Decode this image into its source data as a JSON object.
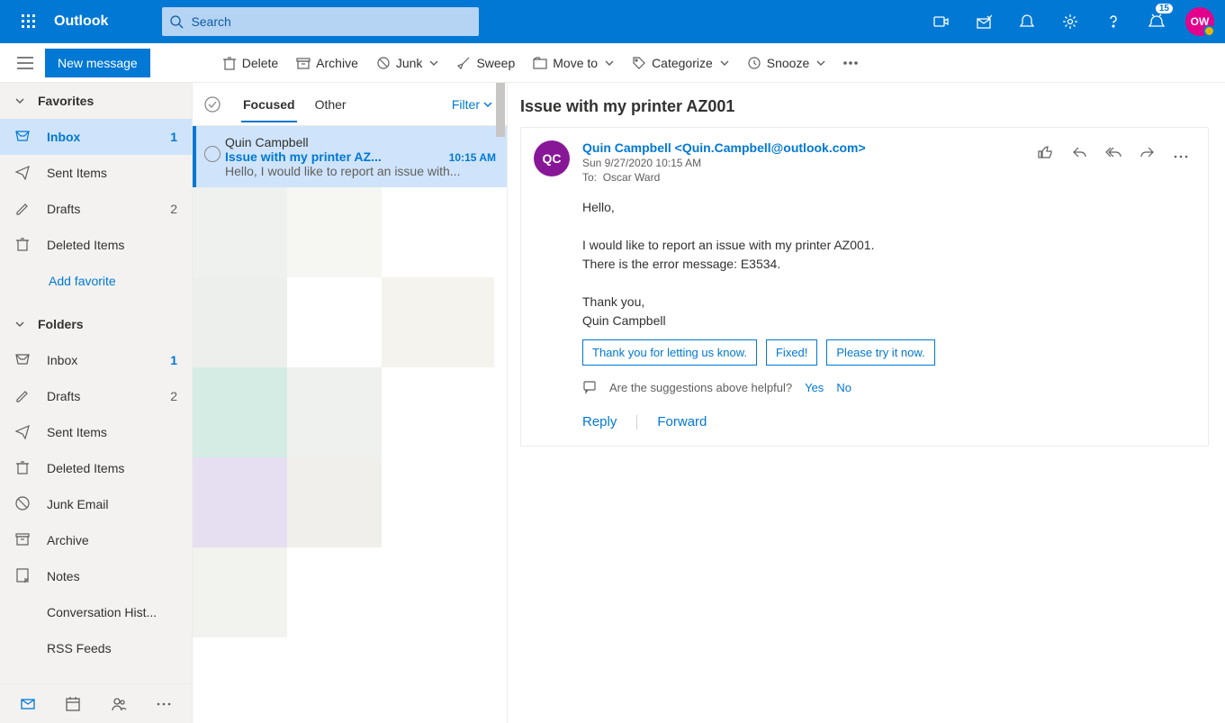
{
  "app": {
    "brand": "Outlook"
  },
  "search": {
    "placeholder": "Search"
  },
  "header": {
    "meet_badge": "15",
    "avatar_initials": "OW"
  },
  "cmdbar": {
    "new_message": "New message",
    "delete": "Delete",
    "archive": "Archive",
    "junk": "Junk",
    "sweep": "Sweep",
    "move_to": "Move to",
    "categorize": "Categorize",
    "snooze": "Snooze"
  },
  "nav": {
    "favorites_header": "Favorites",
    "favorites": [
      {
        "label": "Inbox",
        "count": "1",
        "selected": true,
        "icon": "inbox"
      },
      {
        "label": "Sent Items",
        "icon": "send"
      },
      {
        "label": "Drafts",
        "count": "2",
        "gray": true,
        "icon": "draft"
      },
      {
        "label": "Deleted Items",
        "icon": "trash"
      }
    ],
    "add_favorite": "Add favorite",
    "folders_header": "Folders",
    "folders": [
      {
        "label": "Inbox",
        "count": "1",
        "icon": "inbox"
      },
      {
        "label": "Drafts",
        "count": "2",
        "gray": true,
        "icon": "draft"
      },
      {
        "label": "Sent Items",
        "icon": "send"
      },
      {
        "label": "Deleted Items",
        "icon": "trash"
      },
      {
        "label": "Junk Email",
        "icon": "block"
      },
      {
        "label": "Archive",
        "icon": "archive"
      },
      {
        "label": "Notes",
        "icon": "note"
      },
      {
        "label": "Conversation Hist...",
        "icon": "none"
      },
      {
        "label": "RSS Feeds",
        "icon": "none"
      }
    ]
  },
  "list": {
    "tabs": {
      "focused": "Focused",
      "other": "Other",
      "filter": "Filter"
    },
    "selected": {
      "from": "Quin Campbell",
      "subject": "Issue with my printer AZ...",
      "time": "10:15 AM",
      "preview": "Hello, I would like to report an issue with..."
    }
  },
  "reading": {
    "subject": "Issue with my printer AZ001",
    "avatar_initials": "QC",
    "avatar_color": "#881798",
    "from_display": "Quin Campbell <Quin.Campbell@outlook.com>",
    "date": "Sun 9/27/2020 10:15 AM",
    "to_label": "To:",
    "to_value": "Oscar Ward",
    "body_lines": [
      "Hello,",
      "",
      "I would like to report an issue with my printer AZ001.",
      "There is the error message: E3534.",
      "",
      "Thank you,",
      "Quin Campbell"
    ],
    "suggestions": [
      "Thank you for letting us know.",
      "Fixed!",
      "Please try it now."
    ],
    "helpful_prompt": "Are the suggestions above helpful?",
    "helpful_yes": "Yes",
    "helpful_no": "No",
    "reply": "Reply",
    "forward": "Forward"
  }
}
